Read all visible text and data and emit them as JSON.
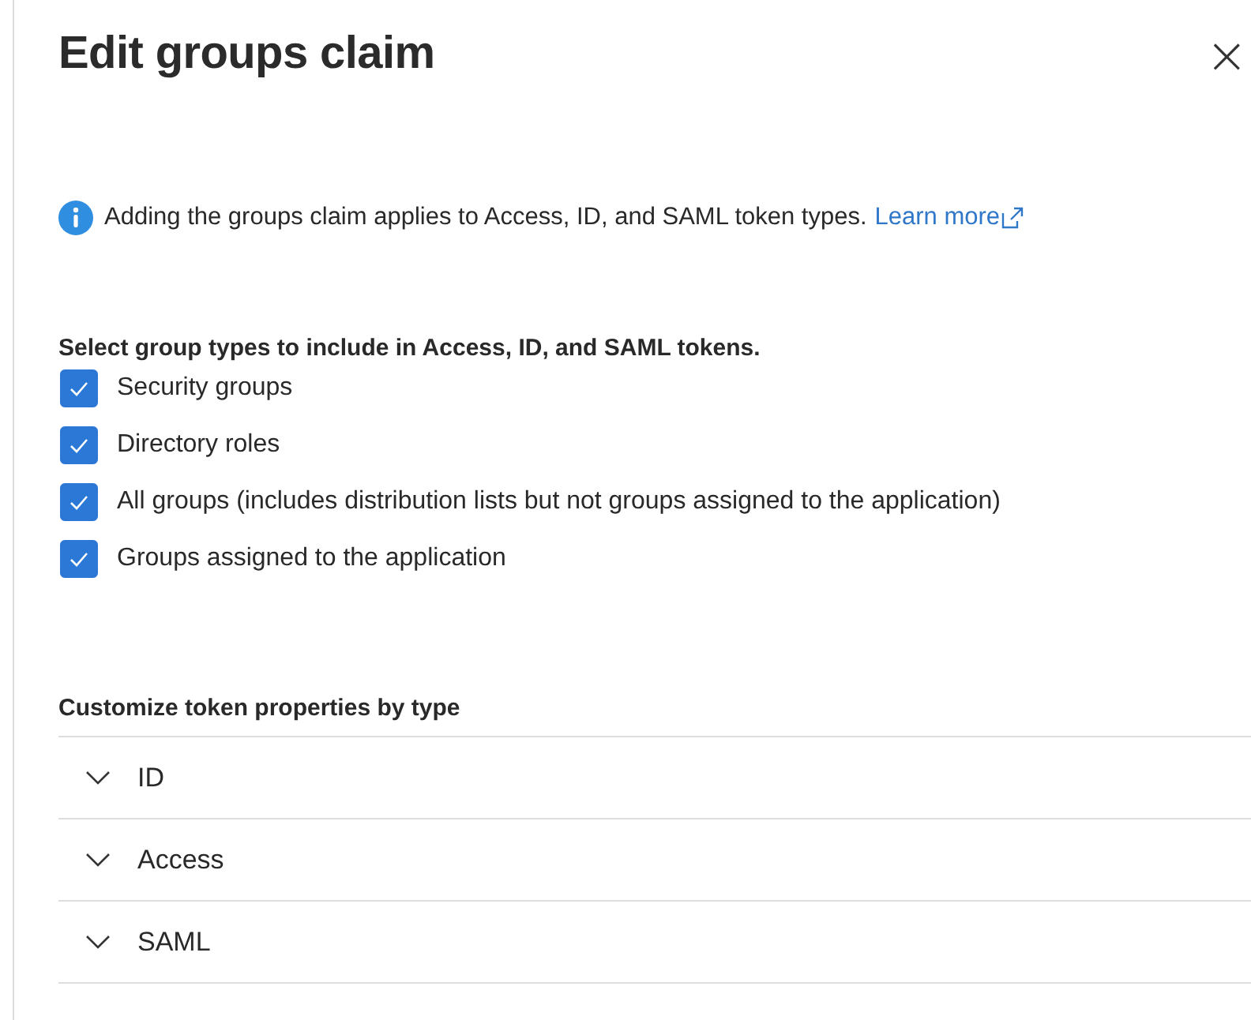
{
  "panel": {
    "title": "Edit groups claim",
    "close": "×"
  },
  "info": {
    "text": "Adding the groups claim applies to Access, ID, and SAML token types.",
    "link": "Learn more"
  },
  "group_types": {
    "heading": "Select group types to include in Access, ID, and SAML tokens.",
    "options": [
      {
        "label": "Security groups",
        "checked": true
      },
      {
        "label": "Directory roles",
        "checked": true
      },
      {
        "label": "All groups (includes distribution lists but not groups assigned to the application)",
        "checked": true
      },
      {
        "label": "Groups assigned to the application",
        "checked": true
      }
    ]
  },
  "token_properties": {
    "heading": "Customize token properties by type",
    "sections": [
      {
        "label": "ID",
        "expanded": false
      },
      {
        "label": "Access",
        "expanded": false
      },
      {
        "label": "SAML",
        "expanded": false
      }
    ]
  }
}
